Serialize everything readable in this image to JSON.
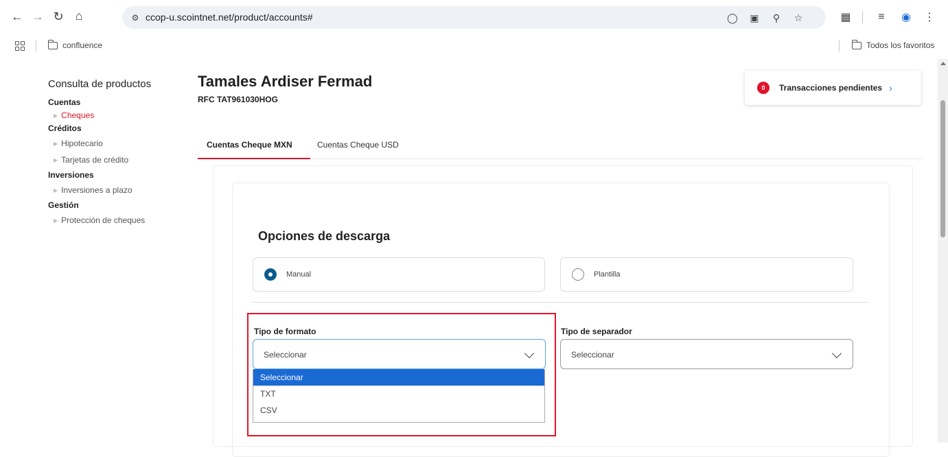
{
  "browser": {
    "url": "ccop-u.scointnet.net/product/accounts#",
    "bookmarks": [
      {
        "label": "confluence"
      }
    ],
    "all_bookmarks_label": "Todos los favoritos"
  },
  "sidebar": {
    "title": "Consulta de productos",
    "sections": [
      {
        "label": "Cuentas",
        "items": [
          {
            "label": "Cheques",
            "active": true
          }
        ]
      },
      {
        "label": "Créditos",
        "items": [
          {
            "label": "Hipotecario"
          },
          {
            "label": "Tarjetas de crédito"
          }
        ]
      },
      {
        "label": "Inversiones",
        "items": [
          {
            "label": "Inversiones a plazo"
          }
        ]
      },
      {
        "label": "Gestión",
        "items": [
          {
            "label": "Protección de cheques"
          }
        ]
      }
    ]
  },
  "customer": {
    "name": "Tamales Ardiser Fermad",
    "rfc": "RFC TAT961030HOG"
  },
  "pending": {
    "count": "0",
    "label": "Transacciones pendientes"
  },
  "tabs": [
    {
      "label": "Cuentas Cheque MXN",
      "active": true
    },
    {
      "label": "Cuentas Cheque USD",
      "active": false
    }
  ],
  "download": {
    "title": "Opciones de descarga",
    "options": [
      {
        "label": "Manual",
        "checked": true
      },
      {
        "label": "Plantilla",
        "checked": false
      }
    ],
    "format": {
      "label": "Tipo de formato",
      "value": "Seleccionar",
      "options": [
        "Seleccionar",
        "TXT",
        "CSV"
      ]
    },
    "separator": {
      "label": "Tipo de separador",
      "value": "Seleccionar"
    }
  },
  "colors": {
    "accent_red": "#e0142b",
    "radio_blue": "#0c5c8e",
    "dropdown_selected": "#1a6ad4"
  }
}
